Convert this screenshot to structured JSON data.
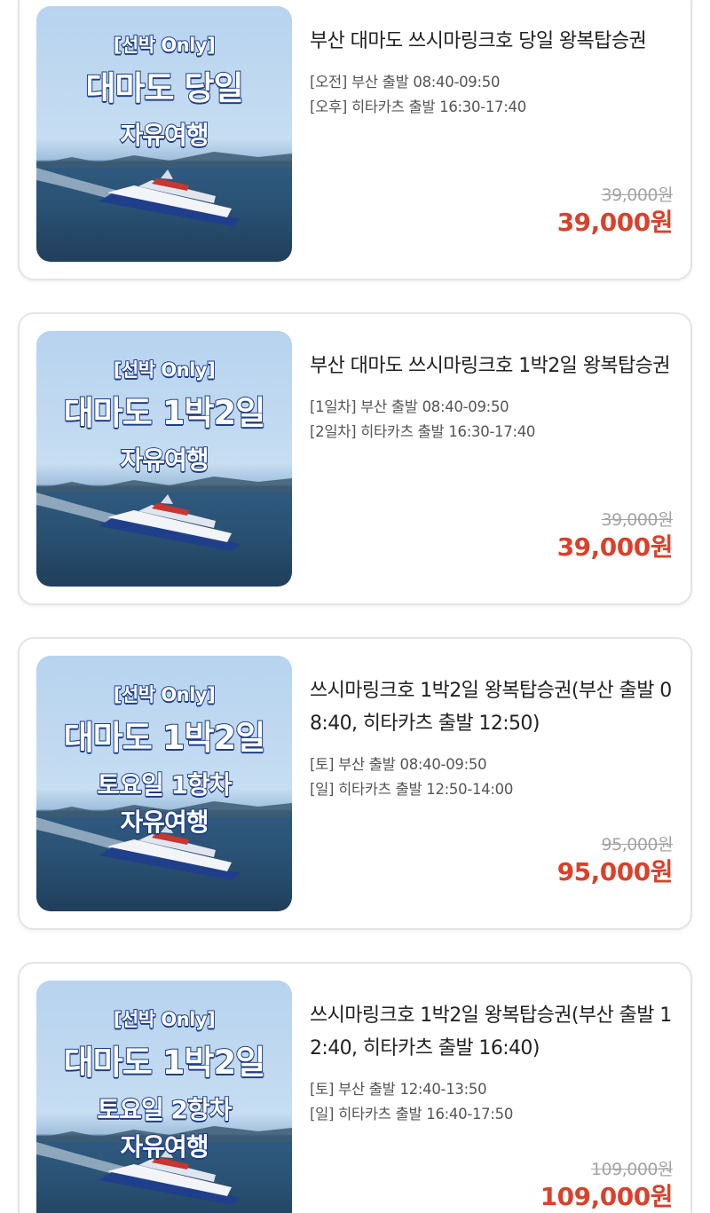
{
  "products": [
    {
      "banner_lines": [
        "[선박 Only]",
        "대마도 당일",
        "자유여행"
      ],
      "title": "부산 대마도 쓰시마링크호 당일 왕복탑승권",
      "schedule": [
        "[오전] 부산 출발 08:40-09:50",
        "[오후] 히타카츠 출발 16:30-17:40"
      ],
      "original_price": "39,000원",
      "sale_price": "39,000원"
    },
    {
      "banner_lines": [
        "[선박 Only]",
        "대마도 1박2일",
        "자유여행"
      ],
      "title": "부산 대마도 쓰시마링크호 1박2일 왕복탑승권",
      "schedule": [
        "[1일차] 부산 출발 08:40-09:50",
        "[2일차] 히타카츠 출발 16:30-17:40"
      ],
      "original_price": "39,000원",
      "sale_price": "39,000원"
    },
    {
      "banner_lines": [
        "[선박 Only]",
        "대마도 1박2일",
        "토요일 1항차",
        "자유여행"
      ],
      "title": "쓰시마링크호 1박2일 왕복탑승권(부산 출발 08:40, 히타카츠 출발 12:50)",
      "schedule": [
        "[토] 부산 출발 08:40-09:50",
        "[일] 히타카츠 출발 12:50-14:00"
      ],
      "original_price": "95,000원",
      "sale_price": "95,000원"
    },
    {
      "banner_lines": [
        "[선박 Only]",
        "대마도 1박2일",
        "토요일 2항차",
        "자유여행"
      ],
      "title": "쓰시마링크호 1박2일 왕복탑승권(부산 출발 12:40, 히타카츠 출발 16:40)",
      "schedule": [
        "[토] 부산 출발 12:40-13:50",
        "[일] 히타카츠 출발 16:40-17:50"
      ],
      "original_price": "109,000원",
      "sale_price": "109,000원"
    }
  ],
  "colors": {
    "sale_price": "#d9412b",
    "banner_text": "#ffffff",
    "banner_outline": "#1d3d86"
  }
}
